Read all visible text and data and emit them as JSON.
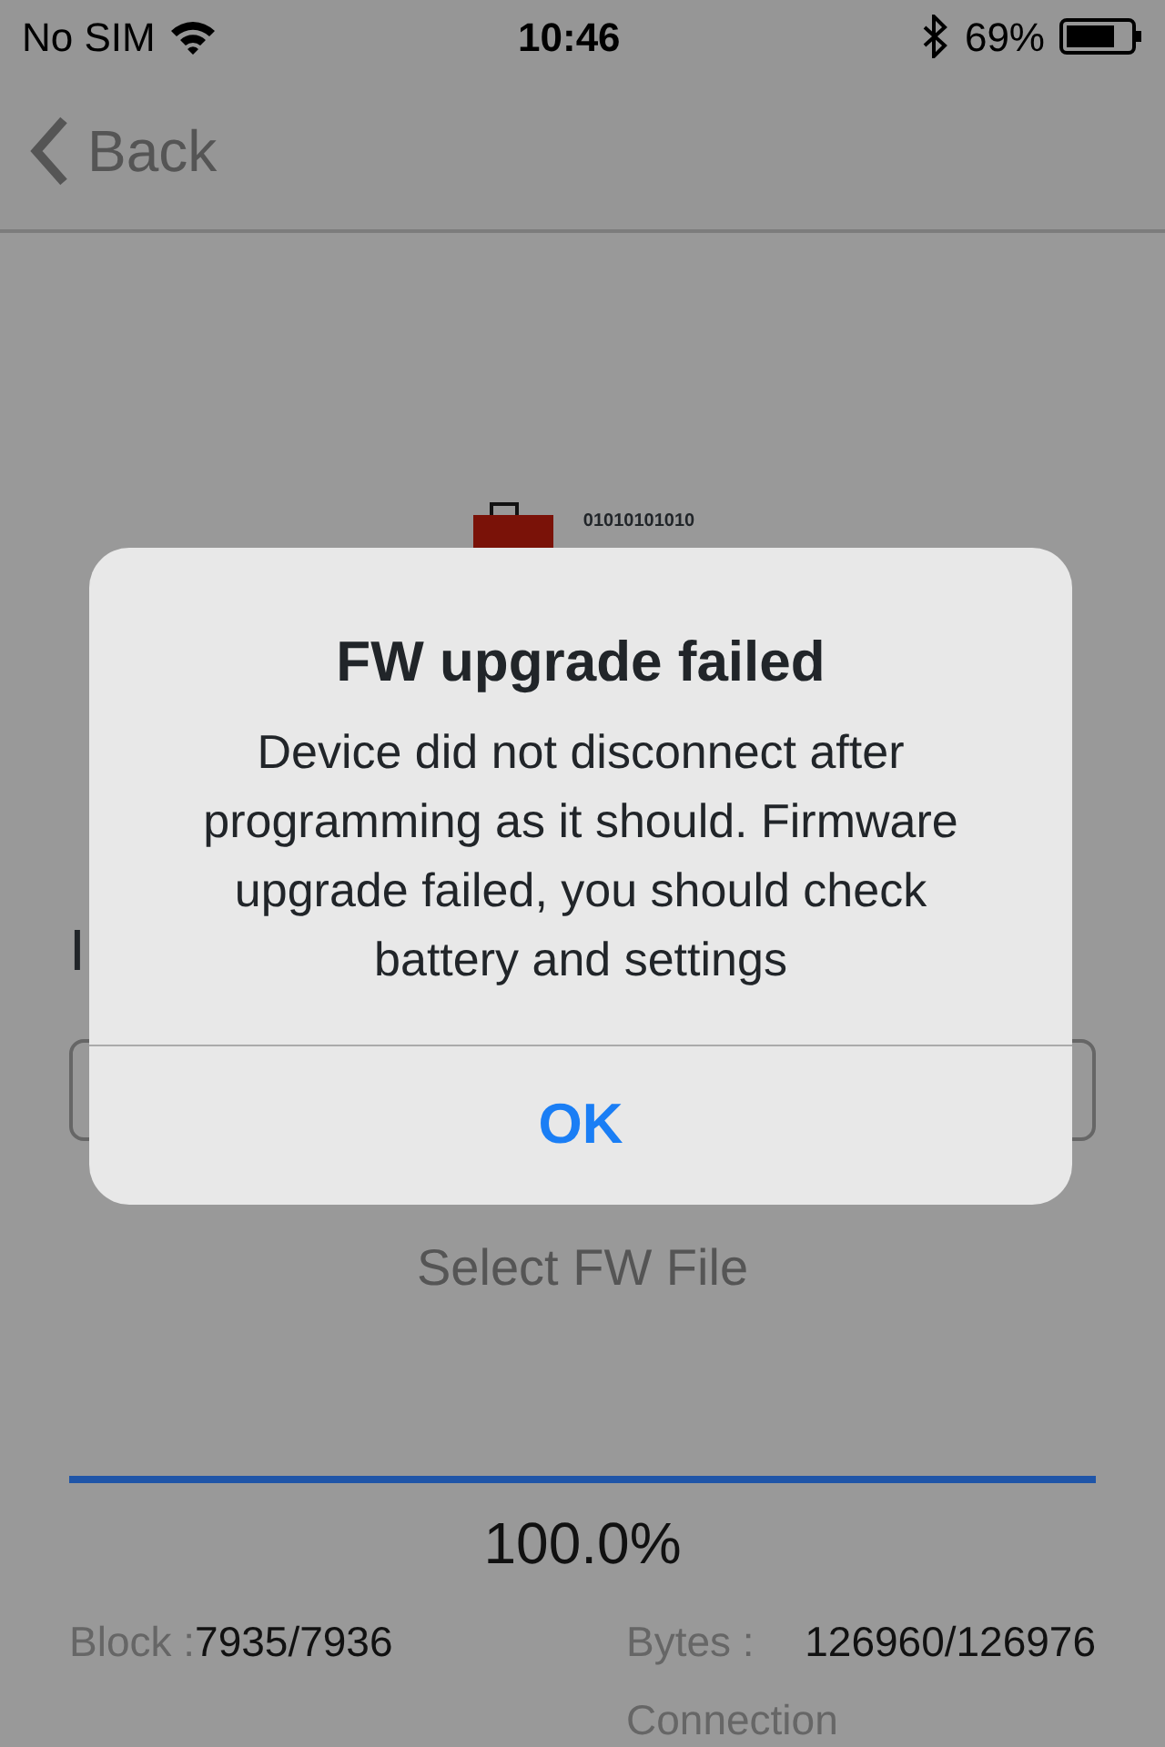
{
  "status_bar": {
    "carrier": "No SIM",
    "time": "10:46",
    "battery": "69%"
  },
  "nav": {
    "back": "Back"
  },
  "device_image": {
    "caption": "01010101010"
  },
  "info_label": "I",
  "select_button": "Select FW File",
  "progress": {
    "level": 1.0,
    "reading": "100.0%"
  },
  "stats": [
    {
      "label": "Block :",
      "value": "7935/7936"
    },
    {
      "label": "Bytes :",
      "value": "126960/126976"
    }
  ],
  "stats_cut": {
    "label": "Connection"
  },
  "alert": {
    "title": "FW upgrade failed",
    "message": "Device did not disconnect after programming as it should. Firmware upgrade failed, you should check battery and settings",
    "button": "OK"
  }
}
